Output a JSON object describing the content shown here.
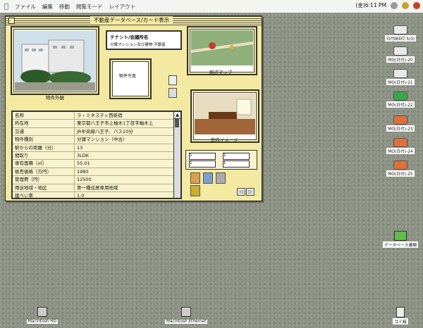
{
  "menubar": {
    "items": [
      "ファイル",
      "編集",
      "移動",
      "閲覧モード",
      "レイアウト"
    ],
    "clock": "(金)6:11 PM",
    "apple_icon": "apple-icon"
  },
  "window": {
    "title": "不動産データベース/カード表示",
    "photo_exterior_caption": "物件外観",
    "photo_map_caption": "周辺マップ",
    "photo_interior_caption": "室内イメージ",
    "name_box_title": "テナント/会議所名",
    "name_box_sub": "分譲マンション及び建物 不動産",
    "thumb_label": "物件写真"
  },
  "table": {
    "rows": [
      {
        "key": "名称",
        "value": "ラ・ミネスティ西新宿"
      },
      {
        "key": "所在地",
        "value": "東京都八王子市上柚木1丁目字柚木上"
      },
      {
        "key": "交通",
        "value": "JR中央線八王子、バス10分"
      },
      {
        "key": "物件種別",
        "value": "分譲マンション（中古）"
      },
      {
        "key": "駅からの距離（分）",
        "value": "13"
      },
      {
        "key": "間取り",
        "value": "3LDK"
      },
      {
        "key": "専有面積（㎡）",
        "value": "55.01"
      },
      {
        "key": "販売価格（万円）",
        "value": "1980"
      },
      {
        "key": "管理費（円）",
        "value": "12500"
      },
      {
        "key": "用途地域・地区",
        "value": "第一種住居専用地域"
      },
      {
        "key": "建ぺい率",
        "value": "1.0"
      }
    ]
  },
  "controls": {
    "field_a": "1",
    "field_b": "1",
    "field_c": "1",
    "field_d": "1",
    "nav_prev": "◁",
    "nav_next": "▷"
  },
  "desktop": {
    "icons": [
      {
        "label": "日付時刻7.5(0)",
        "color": "#e8e8e8"
      },
      {
        "label": "MO(日付)-20",
        "color": "#e8e8e8"
      },
      {
        "label": "MO(日付)-21",
        "color": "#e8e8e8"
      },
      {
        "label": "MO(日付)-22",
        "color": "#3aa84a"
      },
      {
        "label": "MO(日付)-23",
        "color": "#e0703a"
      },
      {
        "label": "MO(日付)-24",
        "color": "#e0703a"
      },
      {
        "label": "MO(日付)-25",
        "color": "#e0703a"
      }
    ],
    "folder_label": "データベース書類",
    "bottom_icons": [
      "Macintosh HD",
      "Macintosh Ethernet",
      "ゴミ箱"
    ]
  }
}
